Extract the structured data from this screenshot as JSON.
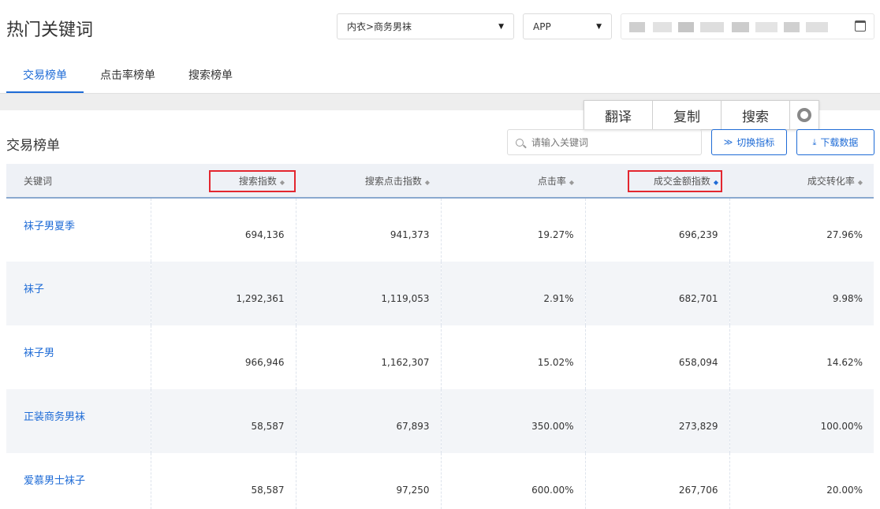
{
  "header": {
    "title": "热门关键词",
    "category_select": "内衣>商务男袜",
    "platform_select": "APP"
  },
  "tabs": [
    "交易榜单",
    "点击率榜单",
    "搜索榜单"
  ],
  "floating_menu": [
    "翻译",
    "复制",
    "搜索"
  ],
  "section": {
    "title": "交易榜单",
    "search_placeholder": "请输入关键词",
    "switch_label": "切换指标",
    "download_label": "下载数据"
  },
  "table": {
    "columns": [
      "关键词",
      "搜索指数",
      "搜索点击指数",
      "点击率",
      "成交金额指数",
      "成交转化率"
    ],
    "rows": [
      {
        "keyword": "袜子男夏季",
        "search_index": "694,136",
        "search_click_index": "941,373",
        "ctr": "19.27%",
        "gmv_index": "696,239",
        "conversion": "27.96%"
      },
      {
        "keyword": "袜子",
        "search_index": "1,292,361",
        "search_click_index": "1,119,053",
        "ctr": "2.91%",
        "gmv_index": "682,701",
        "conversion": "9.98%"
      },
      {
        "keyword": "袜子男",
        "search_index": "966,946",
        "search_click_index": "1,162,307",
        "ctr": "15.02%",
        "gmv_index": "658,094",
        "conversion": "14.62%"
      },
      {
        "keyword": "正装商务男袜",
        "search_index": "58,587",
        "search_click_index": "67,893",
        "ctr": "350.00%",
        "gmv_index": "273,829",
        "conversion": "100.00%"
      },
      {
        "keyword": "爱慕男士袜子",
        "search_index": "58,587",
        "search_click_index": "97,250",
        "ctr": "600.00%",
        "gmv_index": "267,706",
        "conversion": "20.00%"
      }
    ]
  },
  "colors": {
    "accent": "#1e6bd6",
    "highlight_box": "#e3262f"
  }
}
